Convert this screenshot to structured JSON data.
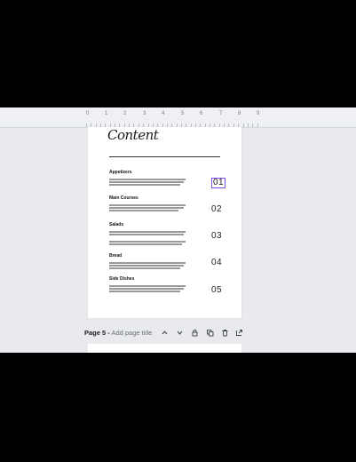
{
  "ruler": {
    "numbers": [
      "0",
      "1",
      "2",
      "3",
      "4",
      "5",
      "6",
      "7",
      "8",
      "9"
    ]
  },
  "page": {
    "title_script": "Content",
    "sections": [
      {
        "heading": "Appetizers",
        "number": "01"
      },
      {
        "heading": "Main Courses",
        "number": "02"
      },
      {
        "heading": "Salads",
        "number": "03"
      },
      {
        "heading": "Bread",
        "number": "04"
      },
      {
        "heading": "Side Dishes",
        "number": "05"
      }
    ]
  },
  "page_bar": {
    "page_number": "Page 5 -",
    "title_placeholder": "Add page title",
    "icons": [
      "chevron-up-icon",
      "chevron-down-icon",
      "lock-icon",
      "duplicate-icon",
      "trash-icon",
      "add-page-icon"
    ]
  },
  "colors": {
    "selection": "#7d4ee8",
    "canvas_bg": "#e8eaee"
  }
}
